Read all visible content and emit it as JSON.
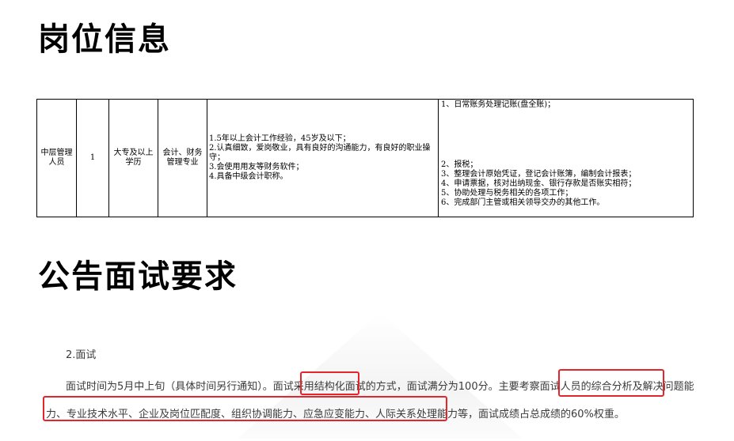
{
  "headings": {
    "job_info": "岗位信息",
    "interview_req": "公告面试要求"
  },
  "job_table": {
    "position": "中层管理人员",
    "count": "1",
    "education": "大专及以上学历",
    "major": "会计、财务管理专业",
    "requirements": [
      "1.5年以上会计工作经验，45岁及以下；",
      "2.认真细致，爱岗敬业，具有良好的沟通能力，有良好的职业操守；",
      "3.会使用用友等财务软件；",
      "4.具备中级会计职称。"
    ],
    "duties": [
      "1、日常账务处理记账(盘全账)；",
      "2、报税；",
      "3、整理会计原始凭证，登记会计账簿，编制会计报表；",
      "4、申请票据，核对出纳现金、银行存款是否账实相符；",
      "5、协助处理与税务相关的各项工作；",
      "6、完成部门主管或相关领导交办的其他工作。"
    ]
  },
  "interview": {
    "subheading": "2.面试",
    "paragraph_line1": "面试时间为5月中上旬（具体时间另行通知）。面试采用结构化面试的方式，面试满分为100分。主要考察面试人员的综合分析及解决问题能",
    "paragraph_line2": "力、专业技术水平、企业及岗位匹配度、组织协调能力、应急应变能力、人际关系处理能力等，面试成绩占总成绩的60%权重。"
  },
  "colors": {
    "highlight": "#e4252e",
    "body_text": "#3b3b3b"
  }
}
